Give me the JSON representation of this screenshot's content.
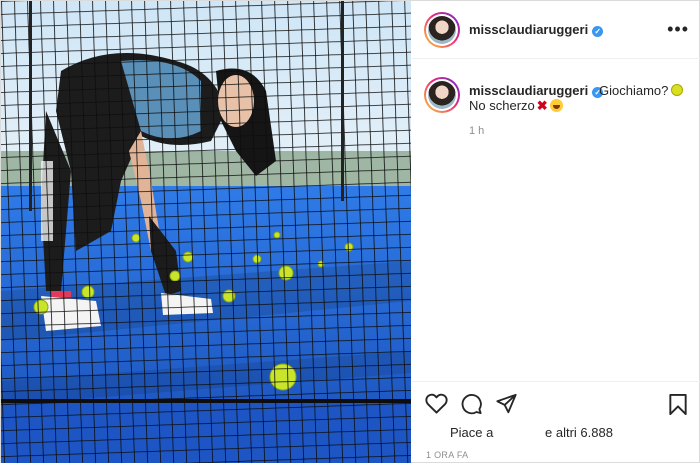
{
  "post": {
    "image": {
      "court_color": "#1f5fd0",
      "net_color": "#0d0d0d",
      "ball_color": "#c9e52a"
    },
    "header": {
      "username": "missclaudiaruggeri",
      "verified_mark": "✓",
      "more_label": "•••"
    },
    "caption": {
      "username": "missclaudiaruggeri",
      "verified_mark": "✓",
      "text": "Giochiamo?",
      "line2": "No scherzo",
      "emoji_x": "✖",
      "time": "1 h"
    },
    "actions": {
      "likes_prefix": "Piace a",
      "likes_suffix": "e altri 6.888",
      "time_ago": "1 ORA FA"
    },
    "colors": {
      "verified": "#3897f0",
      "muted_text": "#8e8e8e",
      "ring_start": "#f9ce34",
      "ring_end": "#6228d7"
    }
  }
}
